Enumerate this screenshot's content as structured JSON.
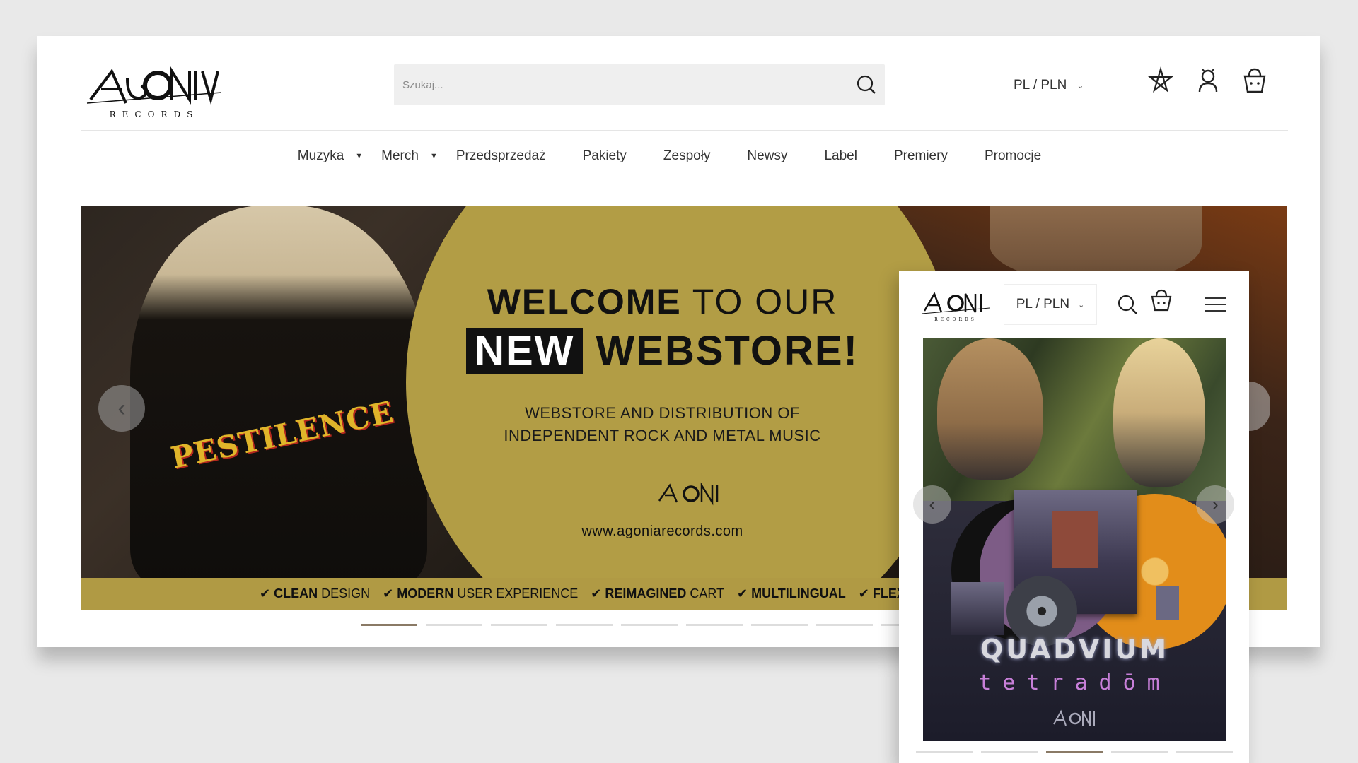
{
  "brand": {
    "name": "AGONIA",
    "sub": "RECORDS"
  },
  "header": {
    "search_placeholder": "Szukaj...",
    "lang": "PL / PLN",
    "icons": [
      "pentagram-icon",
      "user-icon",
      "cart-icon"
    ]
  },
  "nav": {
    "items": [
      {
        "label": "Muzyka",
        "dropdown": true
      },
      {
        "label": "Merch",
        "dropdown": true
      },
      {
        "label": "Przedsprzedaż",
        "dropdown": false
      },
      {
        "label": "Pakiety",
        "dropdown": false
      },
      {
        "label": "Zespoły",
        "dropdown": false
      },
      {
        "label": "Newsy",
        "dropdown": false
      },
      {
        "label": "Label",
        "dropdown": false
      },
      {
        "label": "Premiery",
        "dropdown": false
      },
      {
        "label": "Promocje",
        "dropdown": false
      }
    ]
  },
  "banner": {
    "line1_bold": "WELCOME",
    "line1_rest": " TO OUR",
    "line2_boxed": "NEW",
    "line2_rest": " WEBSTORE!",
    "sub1": "WEBSTORE AND DISTRIBUTION OF",
    "sub2": "INDEPENDENT ROCK AND METAL MUSIC",
    "url": "www.agoniarecords.com",
    "shirt_text": "PESTILENCE",
    "features": [
      {
        "bold": "CLEAN",
        "rest": " DESIGN"
      },
      {
        "bold": "MODERN",
        "rest": " USER EXPERIENCE"
      },
      {
        "bold": "REIMAGINED",
        "rest": " CART"
      },
      {
        "bold": "MULTILINGUAL",
        "rest": ""
      },
      {
        "bold": "FLEX",
        "rest": ""
      }
    ],
    "prev_label": "‹",
    "active_slide": 1,
    "slide_count": 9
  },
  "mobile": {
    "lang": "PL / PLN",
    "banner_title": "QUADVIUM",
    "banner_sub": "tetradōm",
    "prev_label": "‹",
    "next_label": "›",
    "active_slide": 3,
    "slide_count": 5
  },
  "colors": {
    "gold": "#b29d45",
    "strip": "#b09a44",
    "active_dot": "#8a7a66"
  }
}
